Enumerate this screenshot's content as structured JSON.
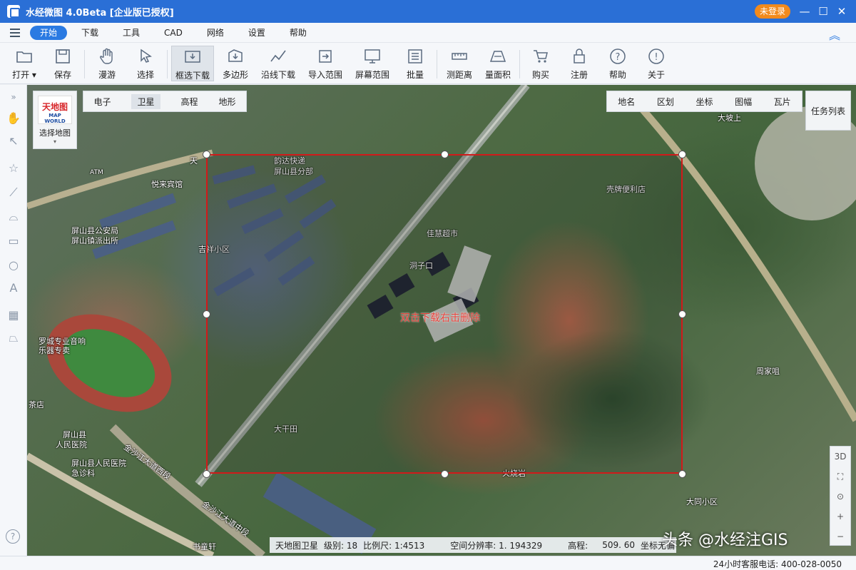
{
  "window": {
    "title": "水经微图 4.0Beta [企业版已授权]",
    "login_label": "未登录",
    "minimize": "—",
    "maximize": "☐",
    "close": "✕"
  },
  "menu": {
    "items": [
      "开始",
      "下载",
      "工具",
      "CAD",
      "网络",
      "设置",
      "帮助"
    ],
    "active": "开始"
  },
  "toolbar": {
    "open": "打开",
    "save": "保存",
    "pan": "漫游",
    "select": "选择",
    "box_download": "框选下载",
    "polygon": "多边形",
    "line_download": "沿线下载",
    "import_range": "导入范围",
    "screen_range": "屏幕范围",
    "batch": "批量",
    "measure_distance": "测距离",
    "measure_area": "量面积",
    "buy": "购买",
    "register": "注册",
    "help": "帮助",
    "about": "关于",
    "selected_tool": "框选下载"
  },
  "map_panel": {
    "select_map_label": "选择地图",
    "brand_cn": "天地图",
    "brand_en": "MAP WORLD",
    "map_types": [
      "电子",
      "卫星",
      "高程",
      "地形"
    ],
    "active_map_type": "卫星",
    "overlays": [
      "地名",
      "区划",
      "坐标",
      "图幅",
      "瓦片"
    ],
    "task_list": "任务列表",
    "zoom_controls": [
      "3D",
      "⛶",
      "⊙",
      "+",
      "−"
    ]
  },
  "map_labels": {
    "hint": "双击下载右击删除",
    "places": [
      {
        "text": "韵达快递"
      },
      {
        "text": "屏山县分部"
      },
      {
        "text": "悦来宾馆"
      },
      {
        "text": "屏山县公安局"
      },
      {
        "text": "屏山镇派出所"
      },
      {
        "text": "吉祥小区"
      },
      {
        "text": "佳慧超市"
      },
      {
        "text": "洞子口"
      },
      {
        "text": "壳牌便利店"
      },
      {
        "text": "大坡上"
      },
      {
        "text": "周家咀"
      },
      {
        "text": "大干田"
      },
      {
        "text": "火烧岩"
      },
      {
        "text": "大同小区"
      },
      {
        "text": "罗城专业音响"
      },
      {
        "text": "乐器专卖"
      },
      {
        "text": "屏山县"
      },
      {
        "text": "人民医院"
      },
      {
        "text": "屏山县人民医院"
      },
      {
        "text": "急诊科"
      },
      {
        "text": "金沙江大道西段"
      },
      {
        "text": "金沙江大道中段"
      },
      {
        "text": "天"
      },
      {
        "text": "ATM"
      },
      {
        "text": "茶店"
      },
      {
        "text": "书童轩"
      }
    ]
  },
  "status": {
    "source": "天地图卫星",
    "level": "级别: 18",
    "scale": "比例尺: 1:4513",
    "resolution": "空间分辨率: 1. 194329",
    "elevation_label": "高程:",
    "elevation_value": "509. 60",
    "coord_label": "坐标无偏",
    "watermark": "头条 @水经注GIS"
  },
  "footer": {
    "phone": "24小时客服电话: 400-028-0050"
  }
}
